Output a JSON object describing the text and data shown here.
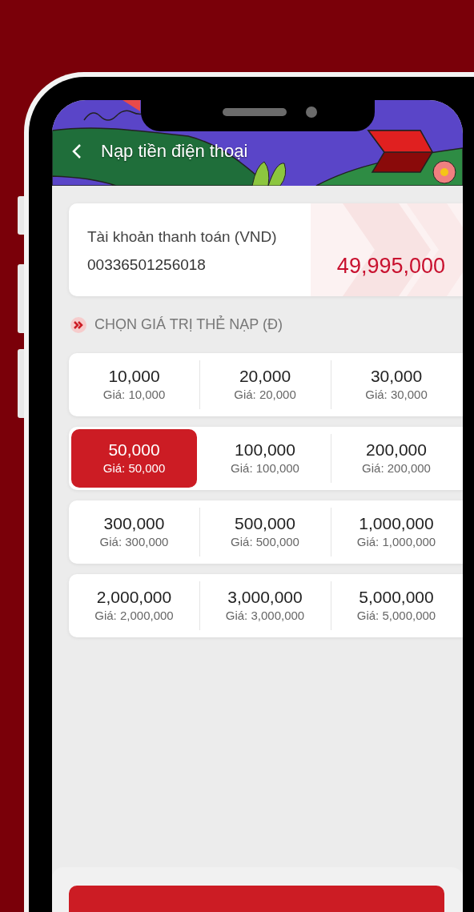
{
  "header": {
    "title": "Nạp tiền điện thoại"
  },
  "account": {
    "label": "Tài khoản thanh toán (VND)",
    "number": "00336501256018",
    "balance": "49,995,000"
  },
  "section_title": "CHỌN GIÁ TRỊ THẺ NẠP (Đ)",
  "denominations": [
    {
      "value": "10,000",
      "price": "Giá: 10,000",
      "selected": false
    },
    {
      "value": "20,000",
      "price": "Giá: 20,000",
      "selected": false
    },
    {
      "value": "30,000",
      "price": "Giá: 30,000",
      "selected": false
    },
    {
      "value": "50,000",
      "price": "Giá: 50,000",
      "selected": true
    },
    {
      "value": "100,000",
      "price": "Giá: 100,000",
      "selected": false
    },
    {
      "value": "200,000",
      "price": "Giá: 200,000",
      "selected": false
    },
    {
      "value": "300,000",
      "price": "Giá: 300,000",
      "selected": false
    },
    {
      "value": "500,000",
      "price": "Giá: 500,000",
      "selected": false
    },
    {
      "value": "1,000,000",
      "price": "Giá: 1,000,000",
      "selected": false
    },
    {
      "value": "2,000,000",
      "price": "Giá: 2,000,000",
      "selected": false
    },
    {
      "value": "3,000,000",
      "price": "Giá: 3,000,000",
      "selected": false
    },
    {
      "value": "5,000,000",
      "price": "Giá: 5,000,000",
      "selected": false
    }
  ]
}
